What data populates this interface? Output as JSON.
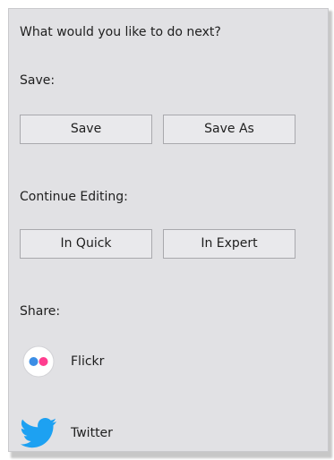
{
  "panel": {
    "question": "What would you like to do next?",
    "save": {
      "heading": "Save:",
      "save_label": "Save",
      "save_as_label": "Save As"
    },
    "continue_editing": {
      "heading": "Continue Editing:",
      "in_quick_label": "In Quick",
      "in_expert_label": "In Expert"
    },
    "share": {
      "heading": "Share:",
      "items": [
        {
          "label": "Flickr",
          "icon": "flickr-icon"
        },
        {
          "label": "Twitter",
          "icon": "twitter-icon"
        }
      ]
    }
  },
  "colors": {
    "panel_bg": "#e1e1e4",
    "button_bg": "#e9e9ec",
    "flickr_blue": "#3c8ee5",
    "flickr_pink": "#ff3d8f",
    "twitter_blue": "#1da1f2"
  }
}
